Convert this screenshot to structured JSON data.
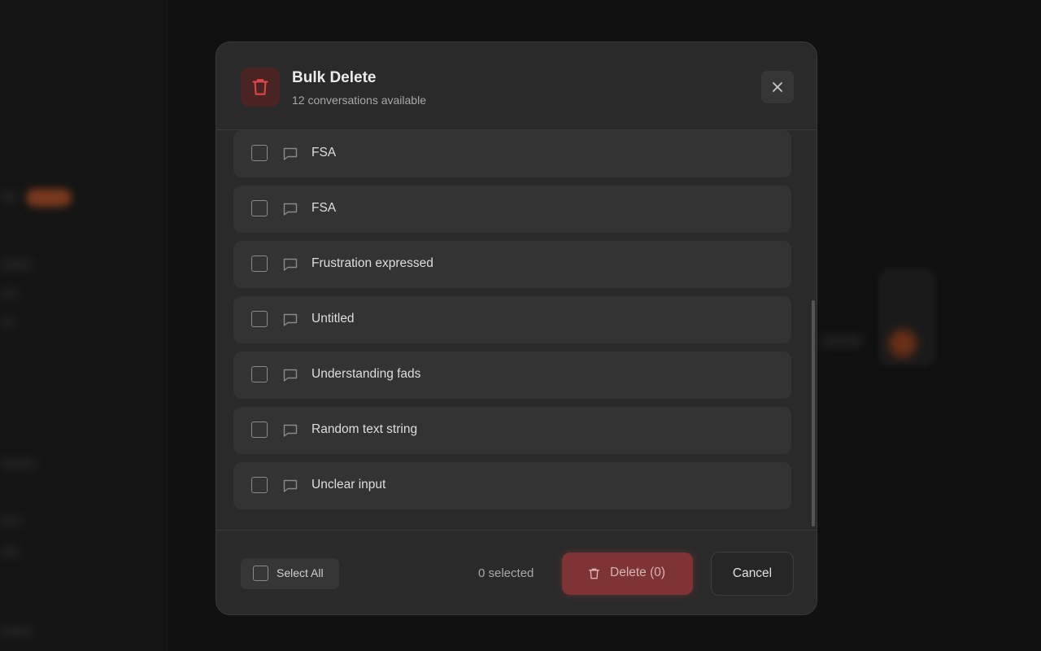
{
  "dialog": {
    "title": "Bulk Delete",
    "subtitle": "12 conversations available",
    "close_icon": "close-icon",
    "header_icon": "trash-icon"
  },
  "conversations": [
    {
      "title": "FSA",
      "checked": false
    },
    {
      "title": "FSA",
      "checked": false
    },
    {
      "title": "Frustration expressed",
      "checked": false
    },
    {
      "title": "Untitled",
      "checked": false
    },
    {
      "title": "Understanding fads",
      "checked": false
    },
    {
      "title": "Random text string",
      "checked": false
    },
    {
      "title": "Unclear input",
      "checked": false
    }
  ],
  "footer": {
    "select_all_label": "Select All",
    "selected_text": "0 selected",
    "delete_label": "Delete (0)",
    "cancel_label": "Cancel"
  },
  "colors": {
    "danger": "#e04848",
    "modal_bg": "#2a2a2a",
    "row_bg": "#333333"
  }
}
